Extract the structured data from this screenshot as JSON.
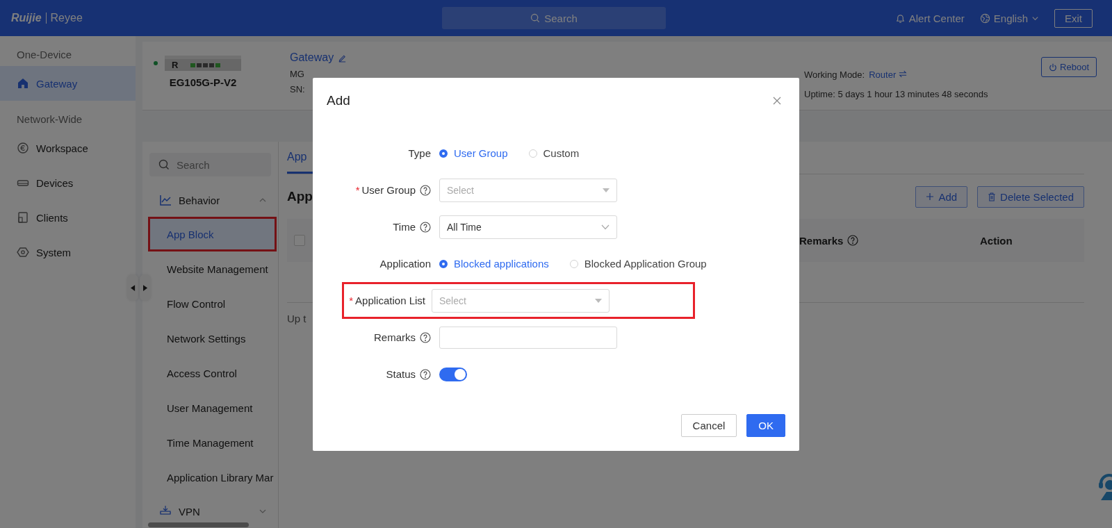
{
  "header": {
    "logo_brand": "Ruijie",
    "logo_product": "Reyee",
    "search_placeholder": "Search",
    "alert": "Alert Center",
    "language": "English",
    "exit": "Exit"
  },
  "nav": [
    {
      "title": "One-Device",
      "items": [
        {
          "label": "Gateway",
          "selected": true
        }
      ]
    },
    {
      "title": "Network-Wide",
      "items": [
        {
          "label": "Workspace",
          "selected": false
        },
        {
          "label": "Devices",
          "selected": false
        },
        {
          "label": "Clients",
          "selected": false
        },
        {
          "label": "System",
          "selected": false
        }
      ]
    }
  ],
  "device": {
    "online": true,
    "badge": "R",
    "model": "EG105G-P-V2",
    "name": "Gateway",
    "mgmt": "MG",
    "sn": "SN:",
    "working_mode_label": "Working Mode:",
    "working_mode": "Router",
    "uptime": "Uptime: 5 days 1 hour 13 minutes 48 seconds",
    "reboot": "Reboot"
  },
  "menu": {
    "search_placeholder": "Search",
    "groups": [
      {
        "label": "Behavior",
        "expanded": true,
        "items": [
          {
            "label": "App Block",
            "selected": true,
            "highlighted": true
          },
          {
            "label": "Website Management",
            "selected": false,
            "highlighted": false
          },
          {
            "label": "Flow Control",
            "selected": false,
            "highlighted": false
          },
          {
            "label": "Network Settings",
            "selected": false,
            "highlighted": false
          },
          {
            "label": "Access Control",
            "selected": false,
            "highlighted": false
          },
          {
            "label": "User Management",
            "selected": false,
            "highlighted": false
          },
          {
            "label": "Time Management",
            "selected": false,
            "highlighted": false
          },
          {
            "label": "Application Library Mar",
            "selected": false,
            "highlighted": false
          }
        ]
      },
      {
        "label": "VPN",
        "expanded": false
      }
    ]
  },
  "content": {
    "tab": "App",
    "heading": "App",
    "add": "Add",
    "delete": "Delete Selected",
    "select_all": {
      "checked": false
    },
    "columns": [
      {
        "label": "Remarks",
        "help": true
      },
      {
        "label": "Action",
        "help": false
      }
    ],
    "footer": "Up t"
  },
  "dialog": {
    "title": "Add",
    "fields": [
      {
        "kind": "radio",
        "label": "Type",
        "help": false,
        "highlighted": false,
        "options": [
          {
            "label": "User Group",
            "selected": true
          },
          {
            "label": "Custom",
            "selected": false
          }
        ]
      },
      {
        "kind": "dropdown",
        "required_mark": "*",
        "label": "User Group",
        "help": true,
        "highlighted": false,
        "placeholder": "Select"
      },
      {
        "kind": "picker",
        "label": "Time",
        "help": true,
        "highlighted": false,
        "value": "All Time"
      },
      {
        "kind": "radio",
        "label": "Application",
        "help": false,
        "highlighted": false,
        "options": [
          {
            "label": "Blocked applications",
            "selected": true
          },
          {
            "label": "Blocked Application Group",
            "selected": false
          }
        ]
      },
      {
        "kind": "dropdown",
        "required_mark": "*",
        "label": "Application List",
        "help": false,
        "highlighted": true,
        "placeholder": "Select"
      },
      {
        "kind": "text",
        "label": "Remarks",
        "help": true,
        "highlighted": false
      },
      {
        "kind": "switch",
        "label": "Status",
        "help": true,
        "highlighted": false,
        "on": true
      }
    ],
    "cancel": "Cancel",
    "ok": "OK"
  }
}
